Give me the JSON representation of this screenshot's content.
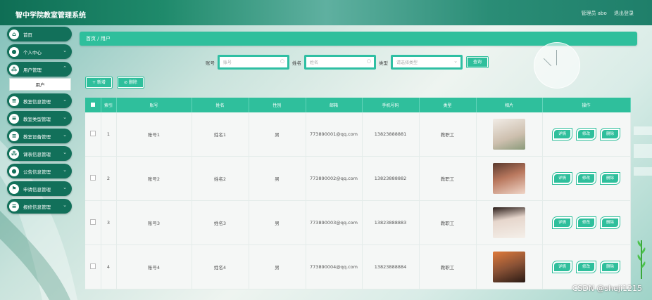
{
  "header": {
    "title": "智中学院教室管理系统",
    "user": "管理员 abo",
    "logout": "退出登录"
  },
  "sidebar": {
    "items": [
      {
        "label": "首页",
        "icon": "home-icon",
        "chev": false
      },
      {
        "label": "个人中心",
        "icon": "user-icon",
        "chev": true
      },
      {
        "label": "用户管理",
        "icon": "users-icon",
        "chev": true
      }
    ],
    "submenu": "用户",
    "items2": [
      {
        "label": "教室信息管理",
        "icon": "list-icon"
      },
      {
        "label": "教室类型管理",
        "icon": "list-icon"
      },
      {
        "label": "教室设备管理",
        "icon": "list-icon"
      },
      {
        "label": "课表信息管理",
        "icon": "grid-icon"
      },
      {
        "label": "公告信息管理",
        "icon": "person-icon"
      },
      {
        "label": "申请信息管理",
        "icon": "flag-icon"
      },
      {
        "label": "报修信息管理",
        "icon": "list-icon"
      }
    ]
  },
  "breadcrumb": "首页 / 用户",
  "search": {
    "account_label": "账号",
    "account_placeholder": "账号",
    "name_label": "姓名",
    "name_placeholder": "姓名",
    "type_label": "类型",
    "type_placeholder": "请选择类型",
    "query_button": "查询"
  },
  "actions": {
    "add": "+ 新增",
    "delete": "⊘ 删除"
  },
  "table": {
    "headers": [
      "",
      "索引",
      "账号",
      "姓名",
      "性别",
      "邮箱",
      "手机号码",
      "类型",
      "相片",
      "操作"
    ],
    "rows": [
      {
        "index": "1",
        "account": "账号1",
        "name": "姓名1",
        "gender": "男",
        "email": "773890001@qq.com",
        "phone": "13823888881",
        "type": "教职工",
        "photo_color": "#cdbfae"
      },
      {
        "index": "2",
        "account": "账号2",
        "name": "姓名2",
        "gender": "男",
        "email": "773890002@qq.com",
        "phone": "13823888882",
        "type": "教职工",
        "photo_color": "#b9785e"
      },
      {
        "index": "3",
        "account": "账号3",
        "name": "姓名3",
        "gender": "男",
        "email": "773890003@qq.com",
        "phone": "13823888883",
        "type": "教职工",
        "photo_color": "#e6d6cc"
      },
      {
        "index": "4",
        "account": "账号4",
        "name": "姓名4",
        "gender": "男",
        "email": "773890004@qq.com",
        "phone": "13823888884",
        "type": "教职工",
        "photo_color": "#8a5236"
      }
    ],
    "ops": {
      "detail": "详情",
      "edit": "修改",
      "delete": "删除"
    }
  },
  "watermark": "CSDN @sheji1215",
  "colors": {
    "accent": "#2fbf9c",
    "sidebar": "#12705a"
  }
}
